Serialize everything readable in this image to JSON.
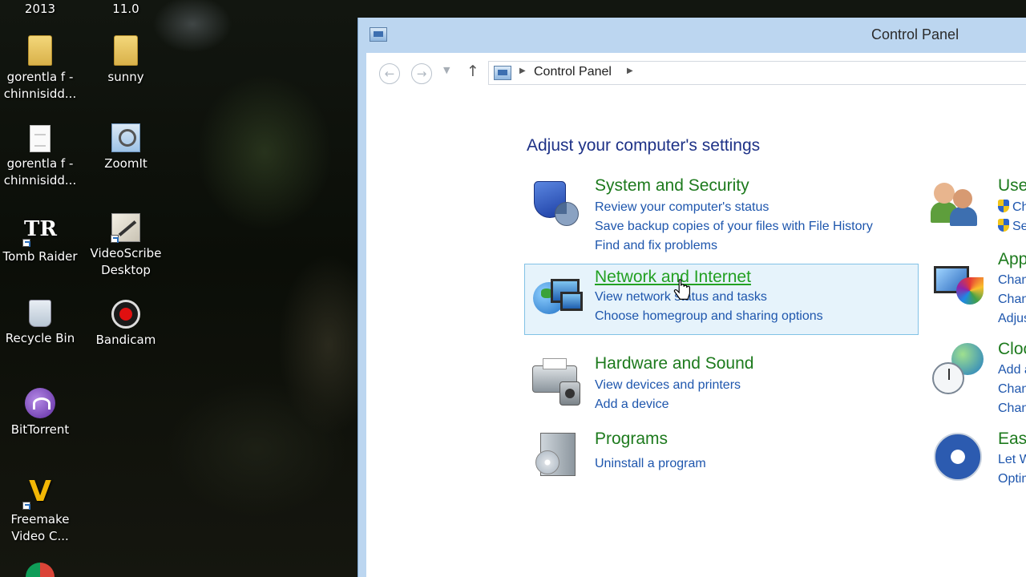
{
  "desktop": {
    "top_labels": [
      "2013",
      "11.0"
    ],
    "icons": [
      {
        "name": "folder-gorentla",
        "label_line1": "gorentla f -",
        "label_line2": "chinnisidd..."
      },
      {
        "name": "folder-sunny",
        "label_line1": "sunny",
        "label_line2": ""
      },
      {
        "name": "file-gorentla",
        "label_line1": "gorentla f -",
        "label_line2": "chinnisidd..."
      },
      {
        "name": "zoomit",
        "label_line1": "ZoomIt",
        "label_line2": ""
      },
      {
        "name": "tomb-raider",
        "label_line1": "Tomb Raider",
        "label_line2": ""
      },
      {
        "name": "videoscribe",
        "label_line1": "VideoScribe",
        "label_line2": "Desktop"
      },
      {
        "name": "recycle-bin",
        "label_line1": "Recycle Bin",
        "label_line2": ""
      },
      {
        "name": "bandicam",
        "label_line1": "Bandicam",
        "label_line2": ""
      },
      {
        "name": "bittorrent",
        "label_line1": "BitTorrent",
        "label_line2": ""
      },
      {
        "name": "freemake",
        "label_line1": "Freemake",
        "label_line2": "Video C..."
      }
    ]
  },
  "window": {
    "title": "Control Panel",
    "address": {
      "crumb": "Control Panel"
    },
    "page_title": "Adjust your computer's settings",
    "categories": [
      {
        "heading": "System and Security",
        "links": [
          "Review your computer's status",
          "Save backup copies of your files with File History",
          "Find and fix problems"
        ]
      },
      {
        "heading": "Network and Internet",
        "links": [
          "View network status and tasks",
          "Choose homegroup and sharing options"
        ]
      },
      {
        "heading": "Hardware and Sound",
        "links": [
          "View devices and printers",
          "Add a device"
        ]
      },
      {
        "heading": "Programs",
        "links": [
          "Uninstall a program"
        ]
      }
    ],
    "right_categories": [
      {
        "heading": "User",
        "links": [
          "Cha",
          "Set"
        ]
      },
      {
        "heading": "Appe",
        "links": [
          "Chang",
          "Chang",
          "Adjust"
        ]
      },
      {
        "heading": "Clock",
        "links": [
          "Add a",
          "Chang",
          "Chang"
        ]
      },
      {
        "heading": "Ease",
        "links": [
          "Let Wi",
          "Optim"
        ]
      }
    ]
  },
  "colors": {
    "heading_green": "#1d7a1d",
    "link_blue": "#1e56ad",
    "title_blue": "#1e3287",
    "highlight_bg": "#e6f3fb",
    "highlight_border": "#82c2e6",
    "window_frame": "#bcd6f0"
  }
}
